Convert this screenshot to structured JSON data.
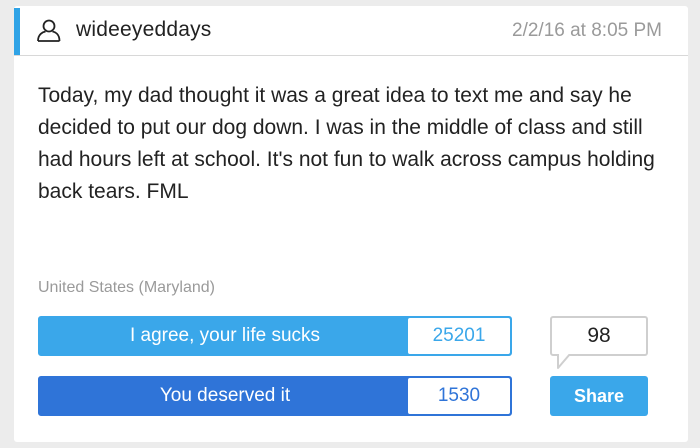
{
  "post": {
    "username": "wideeyeddays",
    "timestamp": "2/2/16 at 8:05 PM",
    "story": "Today, my dad thought it was a great idea to text me and say he decided to put our dog down. I was in the middle of class and still had hours left at school. It's not fun to walk across campus holding back tears. FML",
    "location": "United States (Maryland)"
  },
  "votes": {
    "agree_label": "I agree, your life sucks",
    "agree_count": "25201",
    "deserved_label": "You deserved it",
    "deserved_count": "1530"
  },
  "comments": {
    "count": "98"
  },
  "share": {
    "label": "Share"
  },
  "icons": {
    "user": "user-outline-icon",
    "comment": "speech-bubble-icon"
  },
  "colors": {
    "accent": "#2fa3e6",
    "agree_blue": "#3aa7ea",
    "deserved_blue": "#2f74d8",
    "muted_text": "#9a9a9a"
  }
}
